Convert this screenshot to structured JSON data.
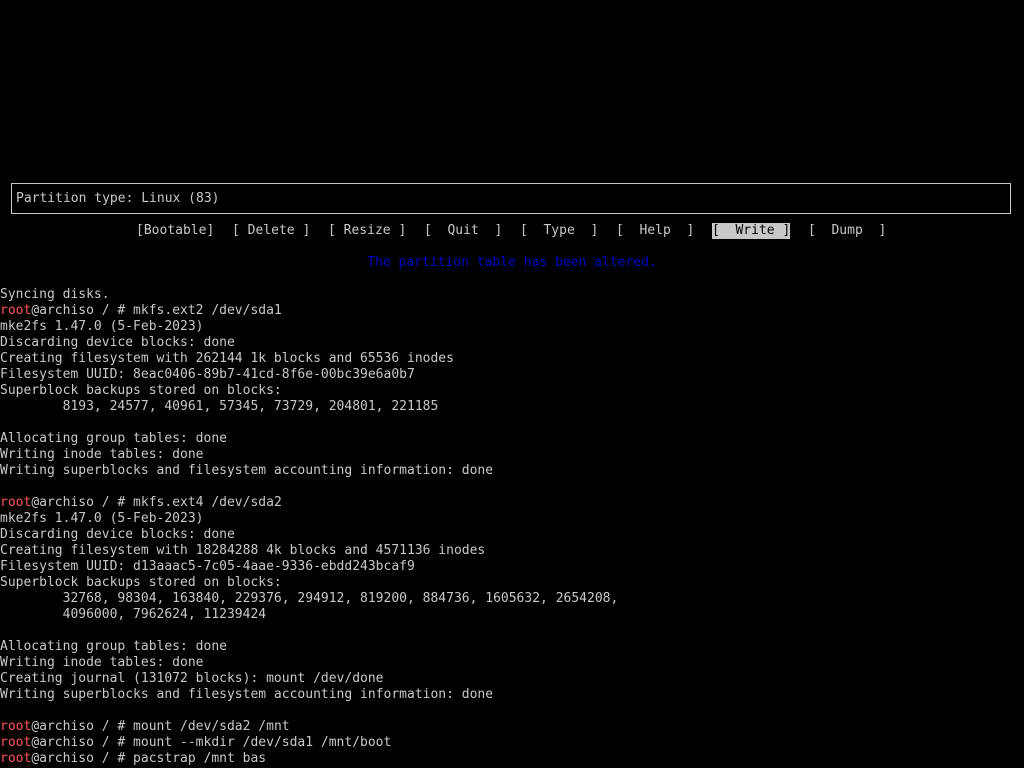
{
  "colors": {
    "background": "#000000",
    "foreground": "#c8c8c8",
    "prompt_user": "#ff5555",
    "status_message": "#0000c8",
    "selected_bg": "#c8c8c8",
    "selected_fg": "#000000"
  },
  "partition_box": {
    "text": "Partition type: Linux (83)"
  },
  "menu": {
    "items": [
      {
        "label": "[Bootable]",
        "selected": false
      },
      {
        "label": "[ Delete ]",
        "selected": false
      },
      {
        "label": "[ Resize ]",
        "selected": false
      },
      {
        "label": "[  Quit  ]",
        "selected": false
      },
      {
        "label": "[  Type  ]",
        "selected": false
      },
      {
        "label": "[  Help  ]",
        "selected": false
      },
      {
        "label": "[  Write ]",
        "selected": true
      },
      {
        "label": "[  Dump  ]",
        "selected": false
      }
    ]
  },
  "status": {
    "message": "The partition table has been altered."
  },
  "terminal": {
    "lines": [
      {
        "text": "Syncing disks."
      },
      {
        "user": "root",
        "text": "@archiso / # mkfs.ext2 /dev/sda1"
      },
      {
        "text": "mke2fs 1.47.0 (5-Feb-2023)"
      },
      {
        "text": "Discarding device blocks: done"
      },
      {
        "text": "Creating filesystem with 262144 1k blocks and 65536 inodes"
      },
      {
        "text": "Filesystem UUID: 8eac0406-89b7-41cd-8f6e-00bc39e6a0b7"
      },
      {
        "text": "Superblock backups stored on blocks:"
      },
      {
        "text": "        8193, 24577, 40961, 57345, 73729, 204801, 221185"
      },
      {
        "text": ""
      },
      {
        "text": "Allocating group tables: done"
      },
      {
        "text": "Writing inode tables: done"
      },
      {
        "text": "Writing superblocks and filesystem accounting information: done"
      },
      {
        "text": ""
      },
      {
        "user": "root",
        "text": "@archiso / # mkfs.ext4 /dev/sda2"
      },
      {
        "text": "mke2fs 1.47.0 (5-Feb-2023)"
      },
      {
        "text": "Discarding device blocks: done"
      },
      {
        "text": "Creating filesystem with 18284288 4k blocks and 4571136 inodes"
      },
      {
        "text": "Filesystem UUID: d13aaac5-7c05-4aae-9336-ebdd243bcaf9"
      },
      {
        "text": "Superblock backups stored on blocks:"
      },
      {
        "text": "        32768, 98304, 163840, 229376, 294912, 819200, 884736, 1605632, 2654208,"
      },
      {
        "text": "        4096000, 7962624, 11239424"
      },
      {
        "text": ""
      },
      {
        "text": "Allocating group tables: done"
      },
      {
        "text": "Writing inode tables: done"
      },
      {
        "text": "Creating journal (131072 blocks): mount /dev/done"
      },
      {
        "text": "Writing superblocks and filesystem accounting information: done"
      },
      {
        "text": ""
      },
      {
        "user": "root",
        "text": "@archiso / # mount /dev/sda2 /mnt"
      },
      {
        "user": "root",
        "text": "@archiso / # mount --mkdir /dev/sda1 /mnt/boot"
      },
      {
        "user": "root",
        "text": "@archiso / # pacstrap /mnt bas"
      }
    ]
  }
}
